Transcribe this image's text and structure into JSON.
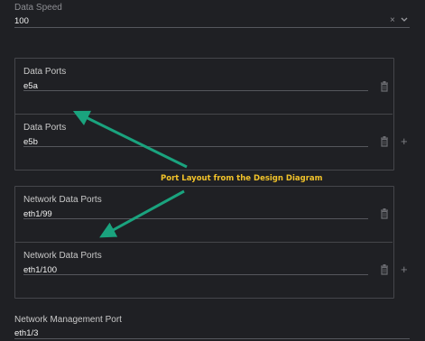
{
  "data_speed": {
    "label": "Data Speed",
    "value": "100"
  },
  "data_ports": [
    {
      "label": "Data Ports",
      "value": "e5a"
    },
    {
      "label": "Data Ports",
      "value": "e5b"
    }
  ],
  "network_data_ports": [
    {
      "label": "Network Data Ports",
      "value": "eth1/99"
    },
    {
      "label": "Network Data Ports",
      "value": "eth1/100"
    }
  ],
  "network_management_port": {
    "label": "Network Management Port",
    "value": "eth1/3"
  },
  "annotation": {
    "text": "Port Layout from the Design Diagram",
    "color": "#f2c32a",
    "arrow_color": "#1aa37e"
  },
  "icons": {
    "clear": "×",
    "chevron": "chevron-down-icon",
    "remove": "trash-icon",
    "add": "+"
  }
}
